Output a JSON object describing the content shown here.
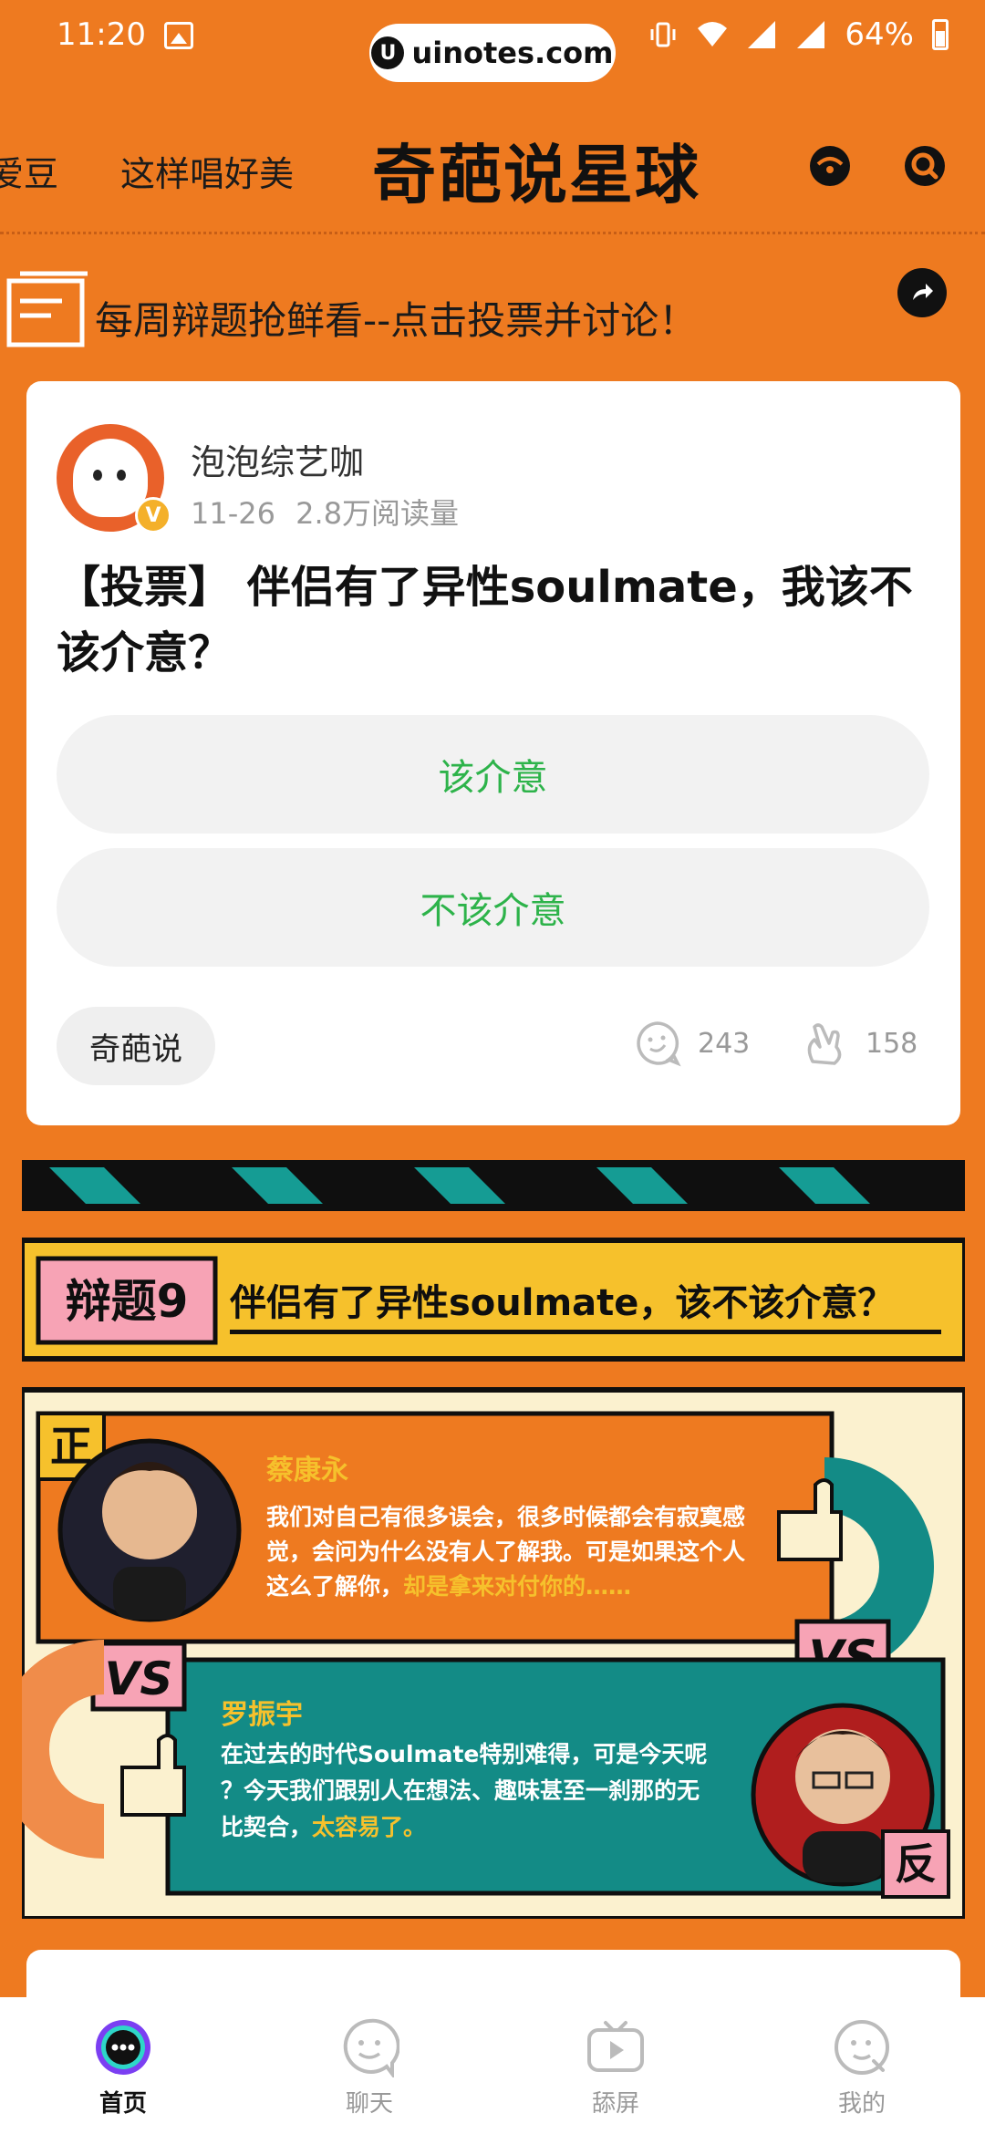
{
  "status_bar": {
    "time": "11:20",
    "url": "uinotes.com",
    "url_logo": "U",
    "battery": "64%"
  },
  "header": {
    "tabs_left": [
      "爱豆",
      "这样唱好美"
    ],
    "title": "奇葩说星球",
    "icons": [
      "emoji-icon",
      "search-icon"
    ]
  },
  "notice": {
    "text": "每周辩题抢鲜看--点击投票并讨论！"
  },
  "post": {
    "author": "泡泡综艺咖",
    "date": "11-26",
    "views": "2.8万阅读量",
    "verified_badge": "V",
    "title": "【投票】 伴侣有了异性soulmate，我该不该介意？",
    "options": [
      "该介意",
      "不该介意"
    ],
    "tag": "奇葩说",
    "comments": "243",
    "likes": "158"
  },
  "banner": {
    "topic_badge": "辩题9",
    "topic_text": "伴侣有了异性soulmate，该不该介意？",
    "pro_mark": "正",
    "con_mark": "反",
    "vs": "VS",
    "pro_name": "蔡康永",
    "pro_quote_lines": [
      "我们对自己有很多误会，很多时候都会有寂寞感",
      "觉，会问为什么没有人了解我。可是如果这个人"
    ],
    "pro_quote_line3": "这么了解你，",
    "pro_quote_highlight": "却是拿来对付你的……",
    "con_name": "罗振宇",
    "con_quote_lines": [
      "在过去的时代Soulmate特别难得，可是今天呢",
      "？今天我们跟别人在想法、趣味甚至一刹那的无"
    ],
    "con_quote_line3": "比契合，",
    "con_quote_highlight": "太容易了。",
    "colors": {
      "orange": "#EE7A20",
      "teal": "#138B86",
      "yellow": "#F6C12C",
      "cream": "#FBF1CF",
      "pink": "#F7A3B5"
    }
  },
  "bottom_nav": {
    "items": [
      {
        "label": "首页",
        "icon": "home-chat-bubble-icon",
        "active": true
      },
      {
        "label": "聊天",
        "icon": "chat-ghost-icon",
        "active": false
      },
      {
        "label": "舔屏",
        "icon": "tv-play-icon",
        "active": false
      },
      {
        "label": "我的",
        "icon": "profile-face-icon",
        "active": false
      }
    ]
  },
  "colors": {
    "background": "#EE7A20",
    "vote_text": "#2DB34A",
    "nav_active_ring": "#7B3FF2"
  }
}
